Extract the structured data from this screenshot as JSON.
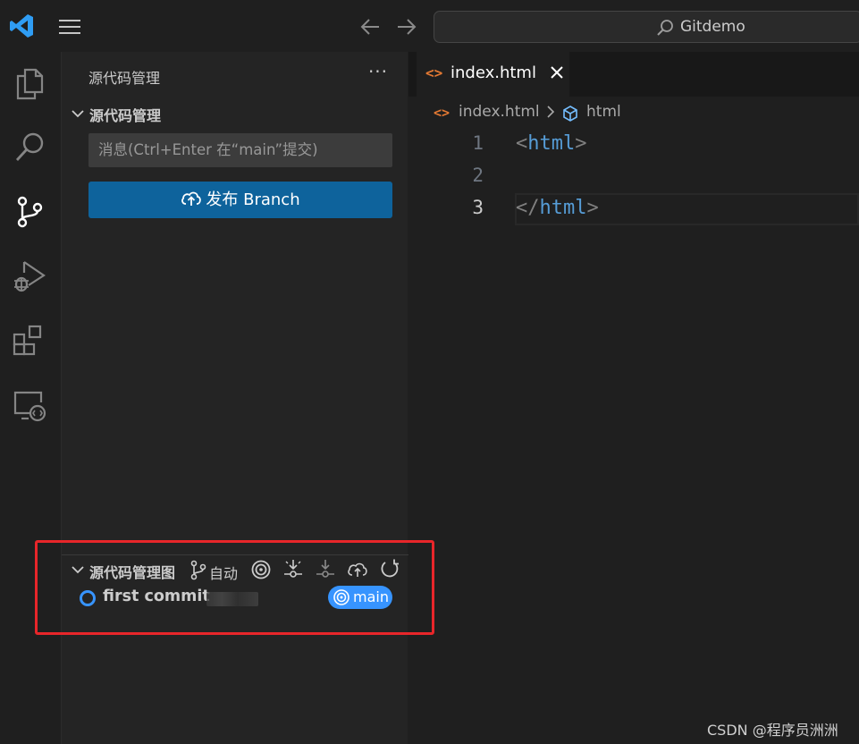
{
  "titlebar": {
    "search_text": "Gitdemo",
    "icons": [
      "vscode-logo-icon",
      "menu-icon",
      "arrow-left-icon",
      "arrow-right-icon",
      "search-icon"
    ]
  },
  "activity_bar": {
    "items": [
      {
        "name": "explorer",
        "icon": "files-icon"
      },
      {
        "name": "search",
        "icon": "search-icon"
      },
      {
        "name": "source-control",
        "icon": "source-control-icon",
        "active": true
      },
      {
        "name": "run-debug",
        "icon": "run-debug-icon"
      },
      {
        "name": "extensions",
        "icon": "extensions-icon"
      },
      {
        "name": "remote-explorer",
        "icon": "remote-explorer-icon"
      }
    ]
  },
  "sidebar": {
    "title": "源代码管理",
    "more": "···",
    "scm_section": {
      "title": "源代码管理",
      "message_placeholder": "消息(Ctrl+Enter 在“main”提交)",
      "publish_label": "发布 Branch"
    },
    "graph_section": {
      "title": "源代码管理图",
      "auto_label": "自动",
      "commits": [
        {
          "message": "first commit",
          "branch": "main"
        }
      ]
    }
  },
  "editor": {
    "tabs": [
      {
        "label": "index.html",
        "icon": "<>"
      }
    ],
    "breadcrumb": {
      "file": "index.html",
      "separator": ">",
      "symbol": "html"
    },
    "lines": [
      {
        "number": "1",
        "open": "<",
        "tag": "html",
        "close": ">"
      },
      {
        "number": "2"
      },
      {
        "number": "3",
        "open": "</",
        "tag": "html",
        "close": ">"
      }
    ]
  },
  "colors": {
    "accent": "#0e639c",
    "branch_badge": "#3794ff",
    "tag": "#569cd6",
    "html_icon": "#e37933",
    "annotation": "#e8262a"
  },
  "watermark": "CSDN @程序员洲洲"
}
